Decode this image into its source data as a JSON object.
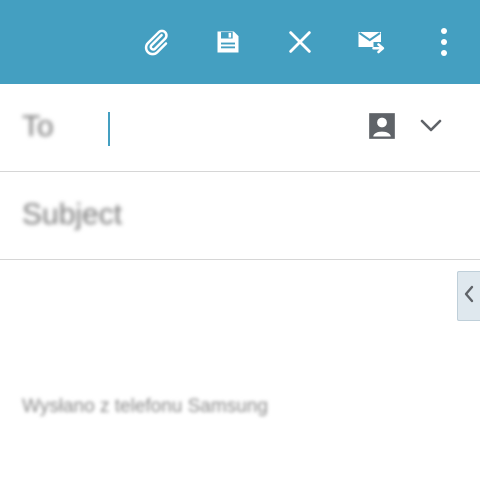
{
  "toolbar": {
    "background": "#449fc1",
    "icons": [
      "paperclip-icon",
      "save-icon",
      "close-icon",
      "send-icon",
      "more-vert-icon"
    ]
  },
  "compose": {
    "to_label": "To",
    "to_value": "",
    "subject_label": "Subject",
    "subject_value": "",
    "signature": "Wysłano z telefonu Samsung"
  },
  "colors": {
    "accent": "#449fc1",
    "icon_white": "#ffffff",
    "icon_gray": "#5f6368",
    "divider": "#d6d6d6"
  }
}
